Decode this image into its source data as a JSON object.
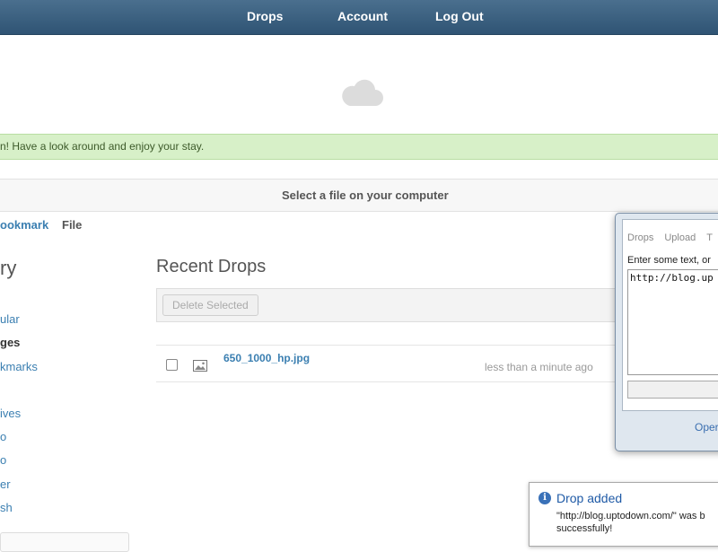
{
  "nav": {
    "drops": "Drops",
    "account": "Account",
    "logout": "Log Out"
  },
  "banner": {
    "text": "n! Have a look around and enjoy your stay."
  },
  "upload": {
    "prompt": "Select a file on your computer",
    "mode_tabs": [
      "ookmark",
      "File"
    ]
  },
  "sidebar": {
    "heading": "ry",
    "items": [
      {
        "label": "ular"
      },
      {
        "label": "ges"
      },
      {
        "label": "kmarks"
      },
      {
        "label": "ives"
      },
      {
        "label": "o"
      },
      {
        "label": "o"
      },
      {
        "label": "er"
      },
      {
        "label": "sh"
      }
    ]
  },
  "main": {
    "title": "Recent Drops",
    "delete_button": "Delete Selected",
    "drops": [
      {
        "name": "650_1000_hp.jpg",
        "time": "less than a minute ago"
      }
    ]
  },
  "popup": {
    "tabs": [
      "Drops",
      "Upload",
      "T"
    ],
    "label": "Enter some text, or",
    "textarea_value": "http://blog.up",
    "open_link": "Oper"
  },
  "toast": {
    "title": "Drop added",
    "message": "\"http://blog.uptodown.com/\" was b successfully!"
  },
  "colors": {
    "nav_bg": "#2f5474",
    "banner_bg": "#d7f0c8",
    "link": "#3b7fb1"
  }
}
